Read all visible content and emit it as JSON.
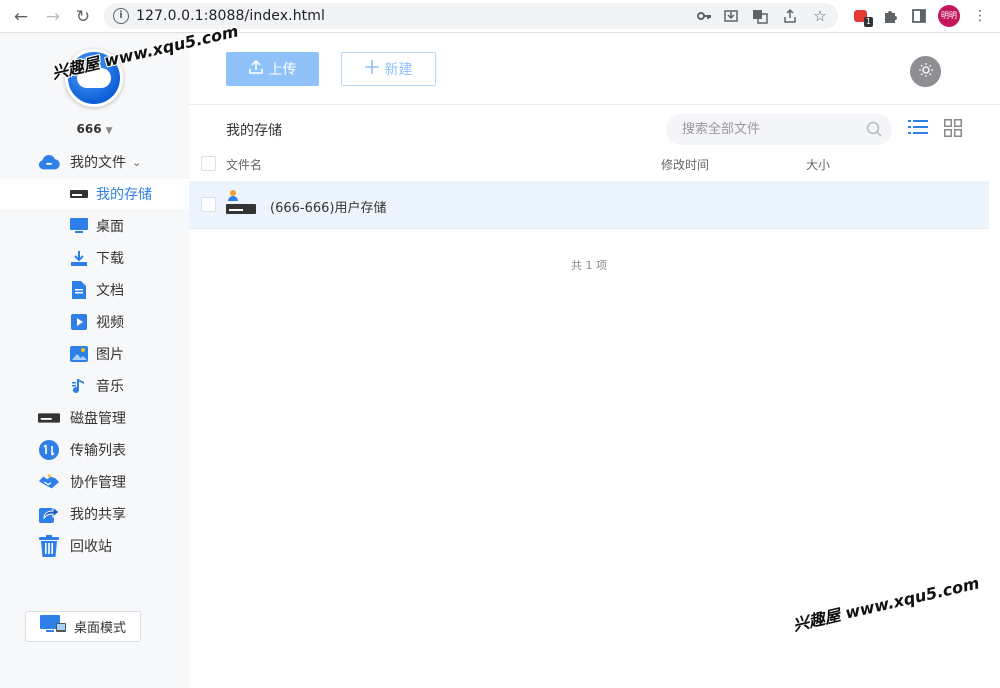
{
  "browser": {
    "url": "127.0.0.1:8088/index.html",
    "profile_label": "明明",
    "extension_badge": "1"
  },
  "sidebar": {
    "username": "666",
    "menu": [
      {
        "label": "我的文件",
        "icon": "cloud-icon"
      },
      {
        "label": "我的存储",
        "icon": "drive-icon"
      },
      {
        "label": "桌面",
        "icon": "monitor-icon"
      },
      {
        "label": "下载",
        "icon": "download-icon"
      },
      {
        "label": "文档",
        "icon": "document-icon"
      },
      {
        "label": "视频",
        "icon": "video-icon"
      },
      {
        "label": "图片",
        "icon": "image-icon"
      },
      {
        "label": "音乐",
        "icon": "music-icon"
      },
      {
        "label": "磁盘管理",
        "icon": "disk-icon"
      },
      {
        "label": "传输列表",
        "icon": "transfer-icon"
      },
      {
        "label": "协作管理",
        "icon": "handshake-icon"
      },
      {
        "label": "我的共享",
        "icon": "share-icon"
      },
      {
        "label": "回收站",
        "icon": "trash-icon"
      }
    ],
    "desktop_mode_label": "桌面模式"
  },
  "toolbar": {
    "upload_label": "上传",
    "new_label": "新建"
  },
  "breadcrumb": "我的存储",
  "search": {
    "placeholder": "搜索全部文件"
  },
  "table": {
    "columns": [
      "文件名",
      "修改时间",
      "大小"
    ],
    "rows": [
      {
        "name": "(666-666)用户存储",
        "modified": "",
        "size": ""
      }
    ],
    "count_text": "共 1 项"
  },
  "watermark": "兴趣屋 www.xqu5.com",
  "colors": {
    "accent": "#2f7fe8",
    "upload_bg": "#8ec2f8",
    "row_selected": "#ecf4fd"
  }
}
